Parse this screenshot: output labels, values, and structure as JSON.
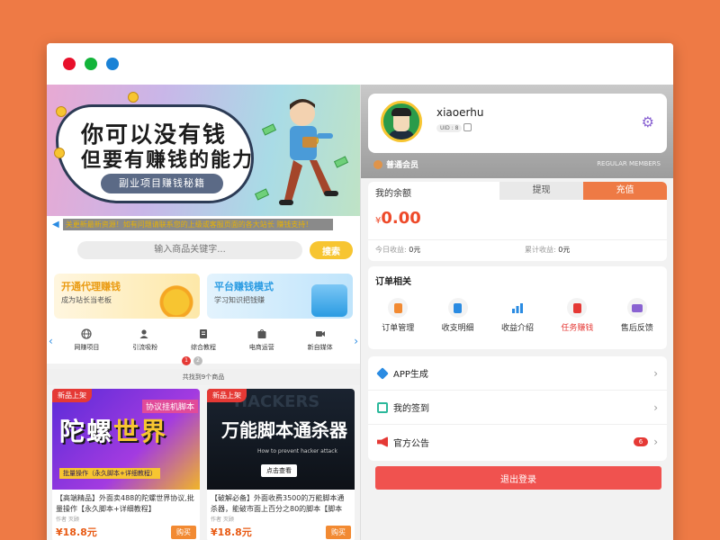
{
  "window": {
    "dots": [
      "#e8102b",
      "#13b43a",
      "#1a82d6"
    ]
  },
  "banner": {
    "line1": "你可以没有钱",
    "line2": "但要有赚钱的能力",
    "pill": "副业项目赚钱秘籍"
  },
  "notice": {
    "text": "关更新最新资源！如有问题请联系您的上级或客服页面的各大站长 赚钱支持！"
  },
  "search": {
    "placeholder": "输入商品关键字...",
    "button": "搜索"
  },
  "promos": [
    {
      "title": "开通代理赚钱",
      "subtitle": "成为站长当老板"
    },
    {
      "title": "平台赚钱模式",
      "subtitle": "学习知识把钱赚"
    }
  ],
  "categories": [
    {
      "label": "网赚项目",
      "icon": "globe-icon"
    },
    {
      "label": "引流吸粉",
      "icon": "user-plus-icon"
    },
    {
      "label": "综合教程",
      "icon": "document-icon"
    },
    {
      "label": "电商运营",
      "icon": "shop-icon"
    },
    {
      "label": "新自媒体",
      "icon": "video-icon"
    }
  ],
  "pager": [
    "1",
    "2"
  ],
  "product_count": "共找到9个商品",
  "products": [
    {
      "tag": "新品上架",
      "img_big_a": "陀螺",
      "img_big_b": "世界",
      "img_sub": "协议挂机脚本",
      "img_foot": "批量操作（永久脚本+详细教程）",
      "desc": "【高端精品】外面卖488的陀螺世界协议,批量操作【永久脚本+详细教程】",
      "author": "作者 灭顾",
      "price": "¥18.8元",
      "buy": "购买"
    },
    {
      "tag": "新品上架",
      "img_bg": "HACKERS",
      "img_big": "万能脚本通杀器",
      "img_sub": "How to prevent hacker attack",
      "img_btn": "点击查看",
      "desc": "【破解必备】外面收费3500的万能脚本通杀器，能破市面上百分之80的脚本【脚本+...",
      "author": "作者 灭顾",
      "price": "¥18.8元",
      "buy": "购买"
    }
  ],
  "user": {
    "name": "xiaoerhu",
    "uid": "UID : 8",
    "member": "普通会员",
    "member_en": "REGULAR MEMBERS"
  },
  "balance": {
    "label": "我的余额",
    "withdraw": "提现",
    "recharge": "充值",
    "amount": "0.00",
    "currency": "¥",
    "today_label": "今日收益:",
    "today_value": "0元",
    "total_label": "累计收益:",
    "total_value": "0元"
  },
  "orders": {
    "title": "订单相关",
    "items": [
      {
        "label": "订单管理",
        "color": "#f28a32"
      },
      {
        "label": "收支明细",
        "color": "#2a8be2"
      },
      {
        "label": "收益介绍",
        "color": "#2a8be2"
      },
      {
        "label": "任务赚钱",
        "color": "#e53935"
      },
      {
        "label": "售后反馈",
        "color": "#8a63d2"
      }
    ]
  },
  "menu": [
    {
      "label": "APP生成",
      "color": "#2a8be2"
    },
    {
      "label": "我的签到",
      "color": "#2bb89b"
    },
    {
      "label": "官方公告",
      "color": "#e53935",
      "badge": "6"
    }
  ],
  "logout": "退出登录",
  "colors": {
    "orange": "#ee7a45",
    "red": "#e53935",
    "yellow": "#f7c531"
  }
}
